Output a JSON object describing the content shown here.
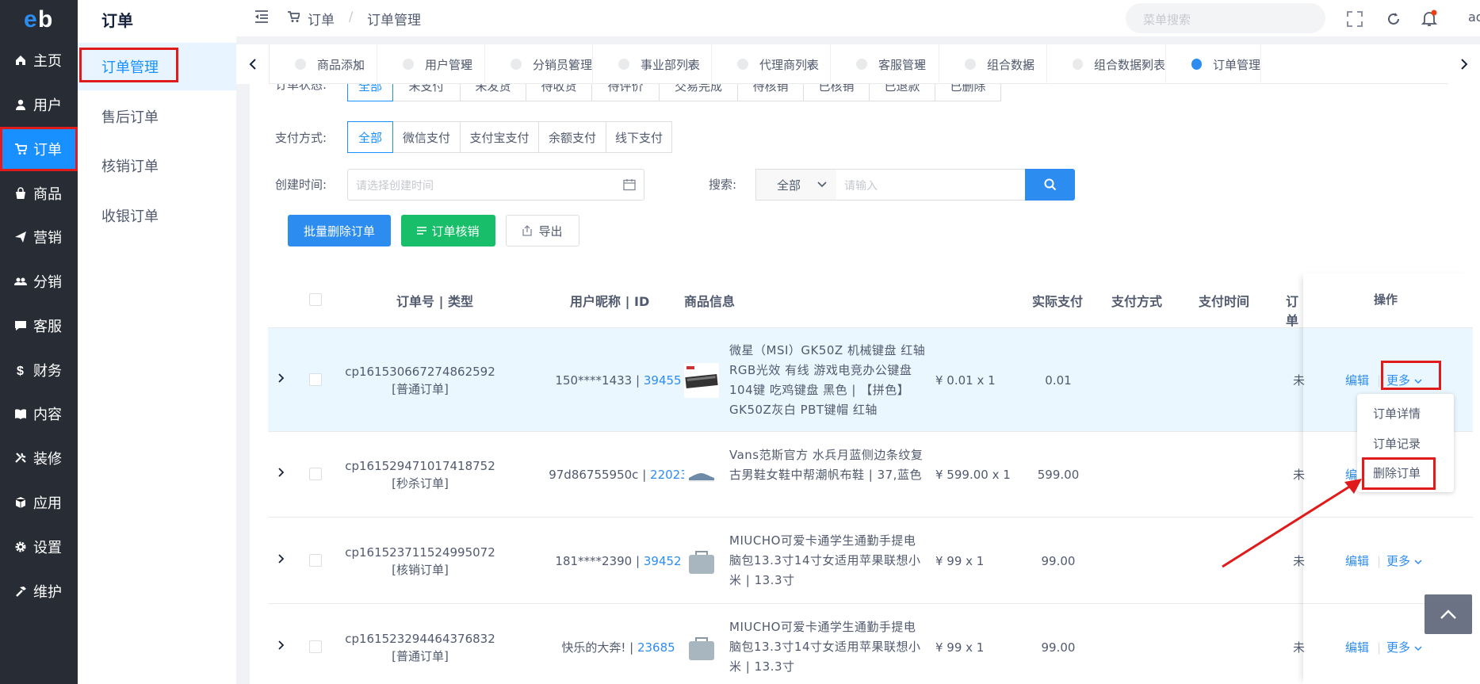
{
  "sidebar": {
    "items": [
      {
        "label": "主页",
        "icon": "home-icon"
      },
      {
        "label": "用户",
        "icon": "user-icon"
      },
      {
        "label": "订单",
        "icon": "cart-icon"
      },
      {
        "label": "商品",
        "icon": "bag-icon"
      },
      {
        "label": "营销",
        "icon": "send-icon"
      },
      {
        "label": "分销",
        "icon": "people-icon"
      },
      {
        "label": "客服",
        "icon": "chat-icon"
      },
      {
        "label": "财务",
        "icon": "dollar-icon"
      },
      {
        "label": "内容",
        "icon": "book-icon"
      },
      {
        "label": "装修",
        "icon": "tools-icon"
      },
      {
        "label": "应用",
        "icon": "cube-icon"
      },
      {
        "label": "设置",
        "icon": "gear-icon"
      },
      {
        "label": "维护",
        "icon": "hammer-icon"
      }
    ],
    "active_index": 2
  },
  "submenu": {
    "title": "订单",
    "items": [
      "订单管理",
      "售后订单",
      "核销订单",
      "收银订单"
    ]
  },
  "header": {
    "breadcrumb_root": "订单",
    "breadcrumb_sep": "/",
    "breadcrumb_current": "订单管理",
    "search_placeholder": "菜单搜索",
    "user_short": "ad"
  },
  "tabs": [
    "商品添加",
    "用户管理",
    "分销员管理",
    "事业部列表",
    "代理商列表",
    "客服管理",
    "组合数据",
    "组合数据列表",
    "订单管理"
  ],
  "filters": {
    "status_label": "订单状态:",
    "status_options": [
      "全部",
      "未支付",
      "未发货",
      "待收货",
      "待评价",
      "交易完成",
      "待核销",
      "已核销",
      "已退款",
      "已删除"
    ],
    "pay_label": "支付方式:",
    "pay_options": [
      "全部",
      "微信支付",
      "支付宝支付",
      "余额支付",
      "线下支付"
    ],
    "time_label": "创建时间:",
    "time_placeholder": "请选择创建时间",
    "search_label": "搜索:",
    "search_scope": "全部",
    "search_placeholder": "请输入"
  },
  "actions": {
    "batch_delete": "批量删除订单",
    "verify": "订单核销",
    "export": "导出"
  },
  "table": {
    "headers": {
      "order": "订单号 | 类型",
      "user": "用户昵称 | ID",
      "goods": "商品信息",
      "paid": "实际支付",
      "pay_method": "支付方式",
      "pay_time": "支付时间",
      "status": "订单",
      "ops": "操作"
    },
    "rows": [
      {
        "order_no": "cp161530667274862592",
        "type": "[普通订单]",
        "nick": "150****1433",
        "uid": "39455",
        "goods": "微星（MSI）GK50Z 机械键盘 红轴 RGB光效 有线 游戏电竞办公键盘 104键 吃鸡键盘 黑色 | 【拼色】GK50Z灰白 PBT键帽 红轴",
        "price": "¥ 0.01 x 1",
        "paid": "0.01",
        "status": "未",
        "edit": "编辑",
        "more": "更多"
      },
      {
        "order_no": "cp161529471017418752",
        "type": "[秒杀订单]",
        "nick": "97d86755950c",
        "uid": "22023",
        "goods": "Vans范斯官方 水兵月蓝侧边条纹复古男鞋女鞋中帮潮帆布鞋 | 37,蓝色",
        "price": "¥ 599.00 x 1",
        "paid": "599.00",
        "status": "未",
        "edit": "编",
        "more": ""
      },
      {
        "order_no": "cp161523711524995072",
        "type": "[核销订单]",
        "nick": "181****2390",
        "uid": "39452",
        "goods": "MIUCHO可爱卡通学生通勤手提电脑包13.3寸14寸女适用苹果联想小米 | 13.3寸",
        "price": "¥ 99 x 1",
        "paid": "99.00",
        "status": "未",
        "edit": "编辑",
        "more": "更多"
      },
      {
        "order_no": "cp161523294464376832",
        "type": "[普通订单]",
        "nick": "快乐的大奔!",
        "uid": "23685",
        "goods": "MIUCHO可爱卡通学生通勤手提电脑包13.3寸14寸女适用苹果联想小米 | 13.3寸",
        "price": "¥ 99 x 1",
        "paid": "99.00",
        "status": "未",
        "edit": "编辑",
        "more": "更多"
      }
    ],
    "sep": "|"
  },
  "dropdown": [
    "订单详情",
    "订单记录",
    "删除订单"
  ],
  "colors": {
    "primary": "#1890ff",
    "success": "#19be6b",
    "annotation": "#e01b1b",
    "nav_bg": "#282c34"
  }
}
